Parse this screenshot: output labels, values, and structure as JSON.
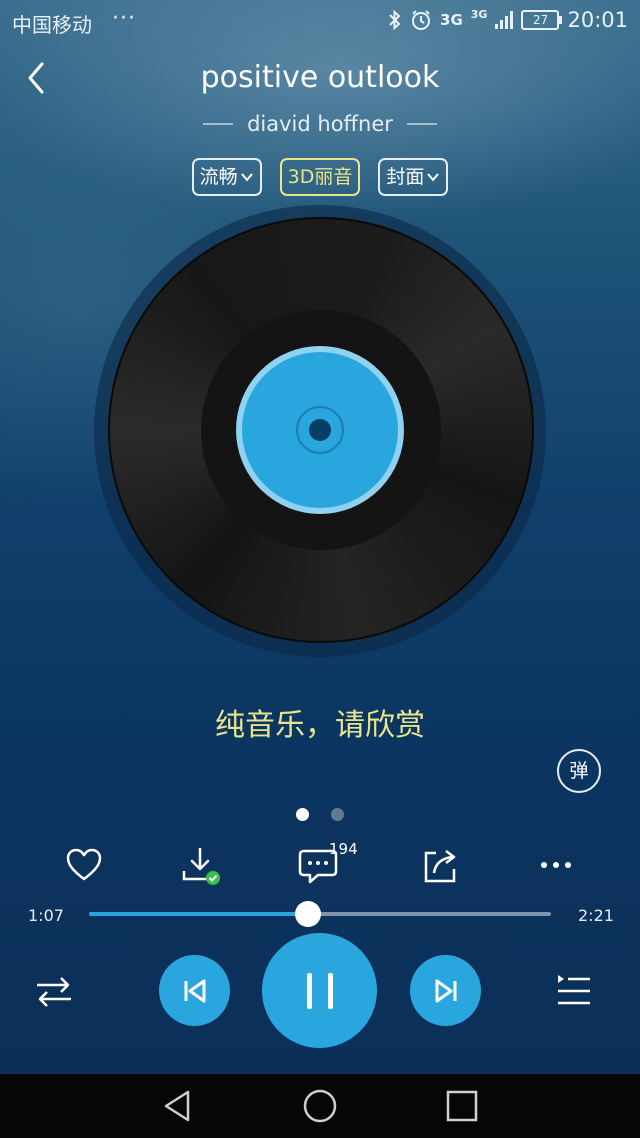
{
  "status_bar": {
    "carrier": "中国移动",
    "more": "···",
    "network_1": "3G",
    "network_2": "3G",
    "battery": "27",
    "time": "20:01"
  },
  "song": {
    "title": "positive outlook",
    "artist": "diavid hoffner"
  },
  "tags": [
    {
      "label": "流畅",
      "has_dropdown": true
    },
    {
      "label": "3D丽音",
      "has_dropdown": false,
      "active": true
    },
    {
      "label": "封面",
      "has_dropdown": true
    }
  ],
  "lyrics": "纯音乐，请欣赏",
  "danmu_label": "弹",
  "comments_count": "194",
  "playback": {
    "current_time": "1:07",
    "duration": "2:21",
    "progress": 0.475,
    "state": "playing"
  },
  "pager": {
    "pages": 2,
    "current": 0
  },
  "colors": {
    "accent": "#2aa6df",
    "lyric": "#e9e58a",
    "download_check": "#39c14a"
  },
  "icons": [
    "back-icon",
    "heart-icon",
    "download-icon",
    "comment-icon",
    "share-icon",
    "more-icon",
    "repeat-icon",
    "prev-icon",
    "pause-icon",
    "next-icon",
    "playlist-icon"
  ]
}
